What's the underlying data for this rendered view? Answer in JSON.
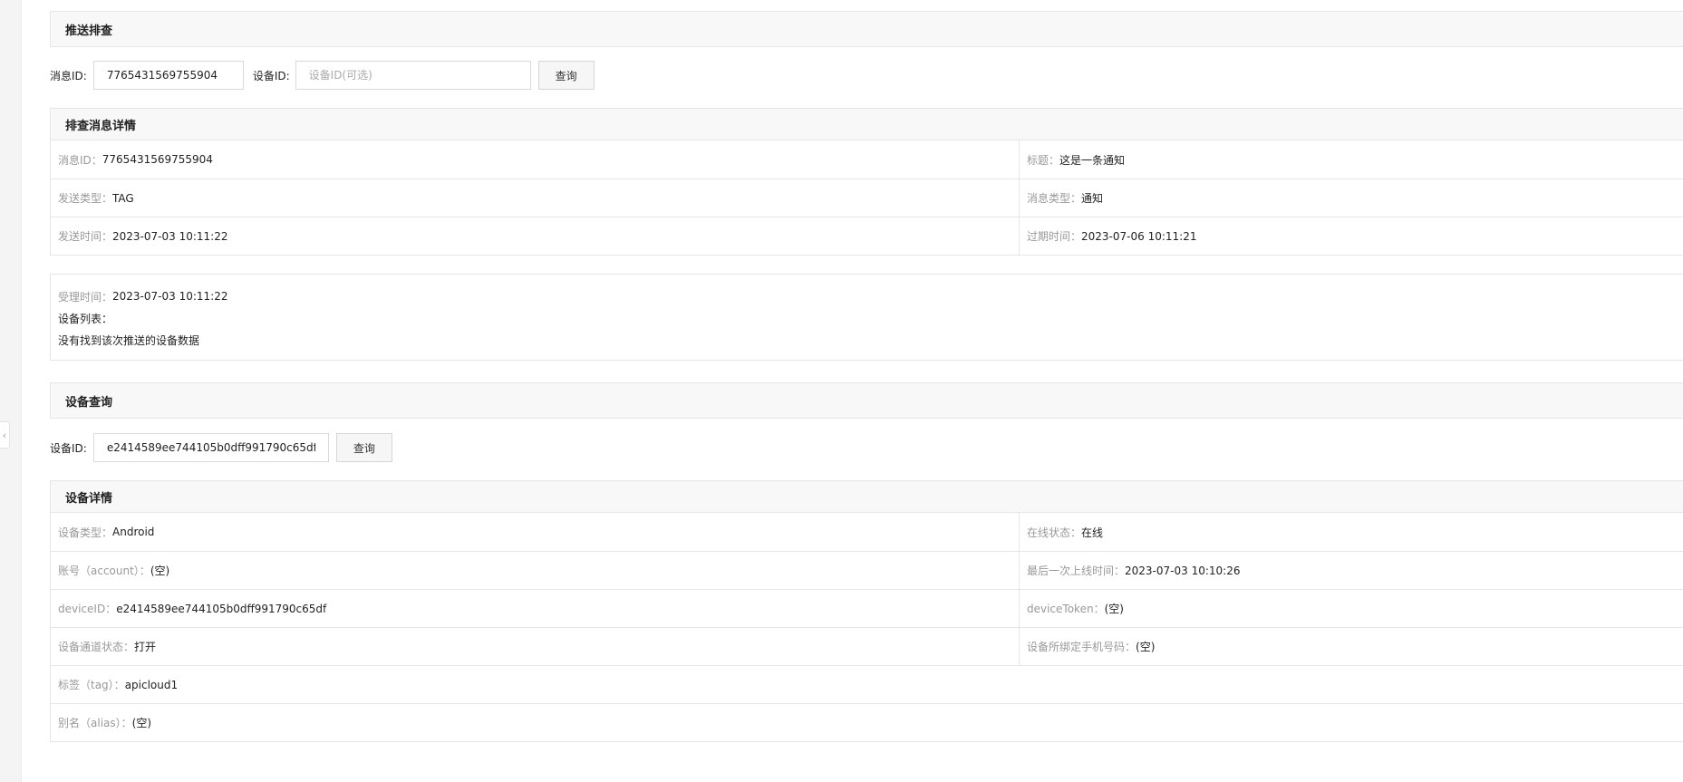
{
  "push_check": {
    "title": "推送排查",
    "msg_id_label": "消息ID:",
    "msg_id_value": "7765431569755904",
    "device_id_label": "设备ID:",
    "device_id_placeholder": "设备ID(可选)",
    "query_button": "查询"
  },
  "message_detail": {
    "title": "排查消息详情",
    "rows": [
      {
        "left_key": "消息ID：",
        "left_value": "7765431569755904",
        "right_key": "标题：",
        "right_value": "这是一条通知"
      },
      {
        "left_key": "发送类型：",
        "left_value": "TAG",
        "right_key": "消息类型：",
        "right_value": "通知"
      },
      {
        "left_key": "发送时间：",
        "left_value": "2023-07-03 10:11:22",
        "right_key": "过期时间：",
        "right_value": "2023-07-06 10:11:21"
      }
    ]
  },
  "receipt": {
    "accept_time_key": "受理时间：",
    "accept_time_value": "2023-07-03 10:11:22",
    "device_list_label": "设备列表：",
    "empty_message": "没有找到该次推送的设备数据"
  },
  "device_query": {
    "title": "设备查询",
    "device_id_label": "设备ID:",
    "device_id_value": "e2414589ee744105b0dff991790c65df",
    "query_button": "查询"
  },
  "device_detail": {
    "title": "设备详情",
    "rows": [
      {
        "left_key": "设备类型：",
        "left_value": "Android",
        "right_key": "在线状态：",
        "right_value": "在线"
      },
      {
        "left_key": "账号（account）：",
        "left_value": "(空)",
        "right_key": "最后一次上线时间：",
        "right_value": "2023-07-03 10:10:26"
      },
      {
        "left_key": "deviceID：",
        "left_value": "e2414589ee744105b0dff991790c65df",
        "right_key": "deviceToken：",
        "right_value": "(空)"
      },
      {
        "left_key": "设备通道状态：",
        "left_value": "打开",
        "right_key": "设备所绑定手机号码：",
        "right_value": "(空)"
      }
    ],
    "tag_key": "标签（tag）：",
    "tag_value": "apicloud1",
    "alias_key": "别名（alias）：",
    "alias_value": "(空)"
  },
  "sidebar": {
    "collapse_icon": "chevron-left-icon"
  }
}
